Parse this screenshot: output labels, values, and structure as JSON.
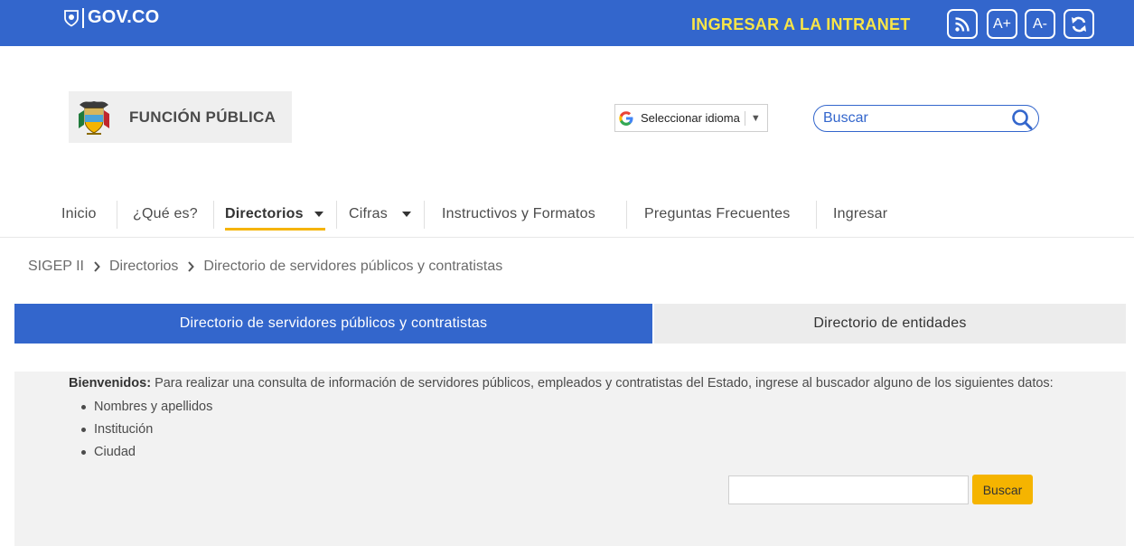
{
  "topbar": {
    "brand": "GOV.CO",
    "intranet_link": "INGRESAR A LA INTRANET",
    "buttons": {
      "aplus": "A+",
      "aminus": "A-"
    }
  },
  "header": {
    "logo_text": "FUNCIÓN PÚBLICA",
    "language_select": "Seleccionar idioma",
    "search_placeholder": "Buscar"
  },
  "nav": {
    "items": [
      {
        "label": "Inicio"
      },
      {
        "label": "¿Qué es?"
      },
      {
        "label": "Directorios"
      },
      {
        "label": "Cifras"
      },
      {
        "label": "Instructivos y Formatos"
      },
      {
        "label": "Preguntas Frecuentes"
      },
      {
        "label": "Ingresar"
      }
    ],
    "active": "Directorios"
  },
  "breadcrumb": [
    "SIGEP II",
    "Directorios",
    "Directorio de servidores públicos y contratistas"
  ],
  "tabs": [
    {
      "label": "Directorio de servidores públicos y contratistas"
    },
    {
      "label": "Directorio de entidades"
    }
  ],
  "content": {
    "welcome_bold": "Bienvenidos:",
    "welcome_text": " Para realizar una consulta de información de servidores públicos, empleados y contratistas del Estado, ingrese al buscador alguno de los siguientes datos:",
    "options": [
      "Nombres y apellidos",
      "Institución",
      "Ciudad"
    ],
    "search_value": "",
    "search_button": "Buscar"
  },
  "colors": {
    "primary": "#3366cc",
    "intranet": "#f9e547",
    "accent": "#f5b400",
    "panel": "#f2f2f2"
  }
}
